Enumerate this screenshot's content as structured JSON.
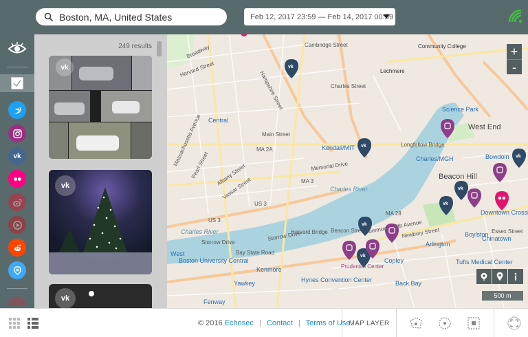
{
  "search": {
    "value": "Boston, MA, United States"
  },
  "date_range": {
    "value": "Feb 12, 2017 23:59 — Feb 14, 2017 00:59"
  },
  "results": {
    "count_label": "249 results"
  },
  "sources": [
    {
      "name": "twitter",
      "color": "#1da1f2",
      "glyph": "t"
    },
    {
      "name": "instagram",
      "color": "#9b2f82",
      "glyph": "◎"
    },
    {
      "name": "vk",
      "color": "#45668e",
      "glyph": "vk"
    },
    {
      "name": "flickr",
      "color": "#ff0084",
      "glyph": "●●"
    },
    {
      "name": "weibo",
      "color": "#e6162d",
      "glyph": "w"
    },
    {
      "name": "youtube",
      "color": "#cc181e",
      "glyph": "▶"
    },
    {
      "name": "reddit",
      "color": "#ff4500",
      "glyph": "r"
    },
    {
      "name": "periscope",
      "color": "#3fa9f5",
      "glyph": "♥"
    }
  ],
  "map": {
    "zoom_in": "+",
    "zoom_out": "-",
    "scale_label": "500 m",
    "labels": {
      "cambridge": "Cambridge Street",
      "hampshire": "Hampshire Street",
      "harvard_st": "Harvard Street",
      "broadway": "Broadway",
      "lechmere": "Lechmere",
      "community_college": "Community College",
      "central": "Central",
      "main_st": "Main Street",
      "charles_st": "Charles Street",
      "kendall": "Kendall/MIT",
      "longfellow": "Longfellow Bridge",
      "charles_mgh": "Charles/MGH",
      "science_park": "Science Park",
      "west_end": "West End",
      "bowdoin": "Bowdoin",
      "beacon_hill": "Beacon Hill",
      "downtown_crossing": "Downtown Crossi",
      "memorial": "Memorial Drive",
      "charles_river": "Charles River",
      "harvard_bridge": "Harvard Bridge",
      "ma_2a": "MA 2A",
      "ma_3": "MA 3",
      "us_3": "US 3",
      "ma_28": "MA 28",
      "storrow": "Storrow Drive",
      "beacon_st": "Beacon Street",
      "commonwealth": "Commonwealth Avenue",
      "newbury": "Newbury Street",
      "arlington": "Arlington",
      "boylston": "Boylston",
      "chinatown": "Chinatown",
      "bay_state": "Bay State Road",
      "bu_central": "Boston University Central",
      "kenmore": "Kenmore",
      "west": "West",
      "prudential": "Prudential Center",
      "copley": "Copley",
      "hynes": "Hynes Convention Center",
      "tufts": "Tufts Medical Center",
      "back_bay": "Back Bay",
      "yawkey": "Yawkey",
      "fenway": "Fenway",
      "albany": "Albany Street",
      "vassar": "Vassar Street",
      "massachusetts": "Massachusetts Avenue",
      "pearl": "Pearl Street",
      "essex": "Essex Street"
    }
  },
  "footer": {
    "copyright": "© 2016",
    "brand": "Echosec",
    "contact": "Contact",
    "terms": "Terms of Use",
    "map_layer": "MAP LAYER",
    "separator": "|"
  },
  "colors": {
    "chrome": "#596a6d",
    "vk_pin": "#2f4a66",
    "instagram_pin": "#8c3f88",
    "flickr_pin": "#e0156f",
    "link": "#1a8fc9"
  }
}
